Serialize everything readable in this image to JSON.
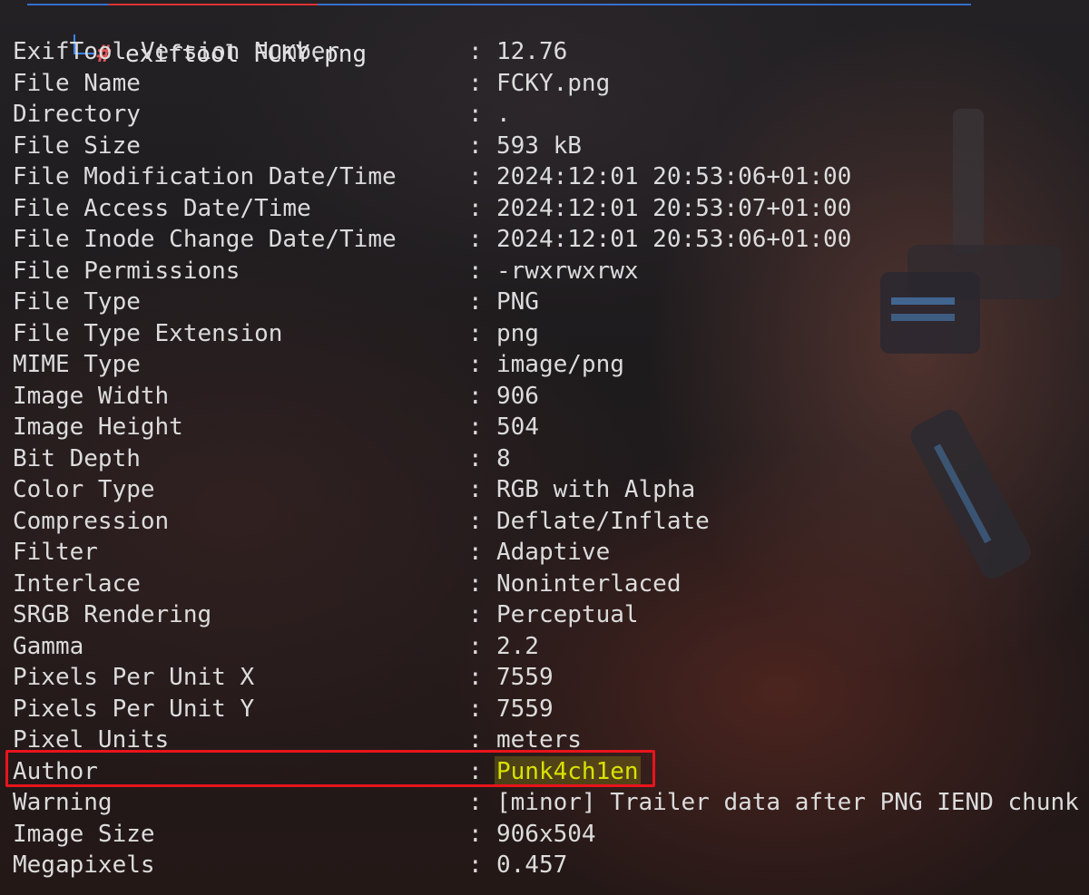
{
  "prompt": {
    "symbol": "#",
    "command": "exiftool FCKY.png"
  },
  "separator": ":",
  "rows": [
    {
      "key": "ExifTool Version Number",
      "value": "12.76"
    },
    {
      "key": "File Name",
      "value": "FCKY.png"
    },
    {
      "key": "Directory",
      "value": "."
    },
    {
      "key": "File Size",
      "value": "593 kB"
    },
    {
      "key": "File Modification Date/Time",
      "value": "2024:12:01 20:53:06+01:00"
    },
    {
      "key": "File Access Date/Time",
      "value": "2024:12:01 20:53:07+01:00"
    },
    {
      "key": "File Inode Change Date/Time",
      "value": "2024:12:01 20:53:06+01:00"
    },
    {
      "key": "File Permissions",
      "value": "-rwxrwxrwx"
    },
    {
      "key": "File Type",
      "value": "PNG"
    },
    {
      "key": "File Type Extension",
      "value": "png"
    },
    {
      "key": "MIME Type",
      "value": "image/png"
    },
    {
      "key": "Image Width",
      "value": "906"
    },
    {
      "key": "Image Height",
      "value": "504"
    },
    {
      "key": "Bit Depth",
      "value": "8"
    },
    {
      "key": "Color Type",
      "value": "RGB with Alpha"
    },
    {
      "key": "Compression",
      "value": "Deflate/Inflate"
    },
    {
      "key": "Filter",
      "value": "Adaptive"
    },
    {
      "key": "Interlace",
      "value": "Noninterlaced"
    },
    {
      "key": "SRGB Rendering",
      "value": "Perceptual"
    },
    {
      "key": "Gamma",
      "value": "2.2"
    },
    {
      "key": "Pixels Per Unit X",
      "value": "7559"
    },
    {
      "key": "Pixels Per Unit Y",
      "value": "7559"
    },
    {
      "key": "Pixel Units",
      "value": "meters"
    },
    {
      "key": "Author",
      "value": "Punk4ch1en"
    },
    {
      "key": "Warning",
      "value": "[minor] Trailer data after PNG IEND chunk"
    },
    {
      "key": "Image Size",
      "value": "906x504"
    },
    {
      "key": "Megapixels",
      "value": "0.457"
    }
  ],
  "colors": {
    "prompt_hash": "#e0555a",
    "prompt_corner": "#3b82f6",
    "highlight_box": "#e8141c",
    "author_value": "#d9e200"
  }
}
